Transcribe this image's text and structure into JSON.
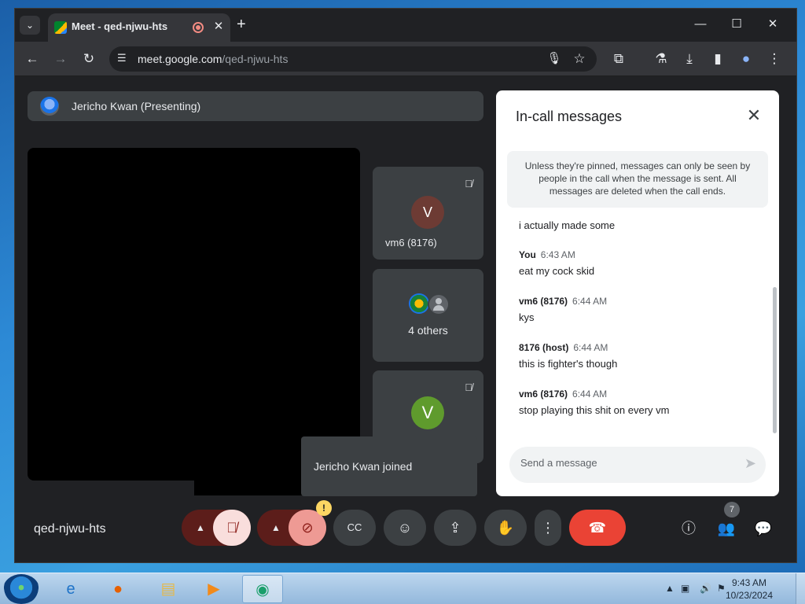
{
  "browser": {
    "tab_title": "Meet - qed-njwu-hts",
    "new_tab_symbol": "+",
    "url_host": "meet.google.com",
    "url_path": "/qed-njwu-hts"
  },
  "window_controls": {
    "minimize": "—",
    "maximize": "☐",
    "close": "✕"
  },
  "meet": {
    "presenting_label": "Jericho Kwan (Presenting)",
    "tiles": [
      {
        "avatar_letter": "V",
        "name": "vm6 (8176)",
        "avatar_color": "#6d3b34"
      },
      {
        "others_label": "4 others"
      },
      {
        "avatar_letter": "V",
        "name": "",
        "avatar_color": "#5f9b2d"
      }
    ],
    "toast": "Jericho Kwan joined",
    "meeting_code": "qed-njwu-hts",
    "participant_count": "7",
    "warning_badge": "!"
  },
  "chat": {
    "title": "In-call messages",
    "notice": "Unless they're pinned, messages can only be seen by people in the call when the message is sent. All messages are deleted when the call ends.",
    "messages": [
      {
        "sender": "",
        "time": "",
        "text": "i actually made some"
      },
      {
        "sender": "You",
        "time": "6:43 AM",
        "text": "eat my cock skid"
      },
      {
        "sender": "vm6 (8176)",
        "time": "6:44 AM",
        "text": "kys"
      },
      {
        "sender": "8176 (host)",
        "time": "6:44 AM",
        "text": "this is fighter's though"
      },
      {
        "sender": "vm6 (8176)",
        "time": "6:44 AM",
        "text": "stop playing this shit on every vm"
      }
    ],
    "input_placeholder": "Send a message"
  },
  "taskbar": {
    "time": "9:43 AM",
    "date": "10/23/2024"
  },
  "colors": {
    "end_call": "#ea4335",
    "mic_off_bg": "#f9dedc",
    "cam_off_bg": "#ee9a94",
    "meet_bg": "#202124"
  }
}
